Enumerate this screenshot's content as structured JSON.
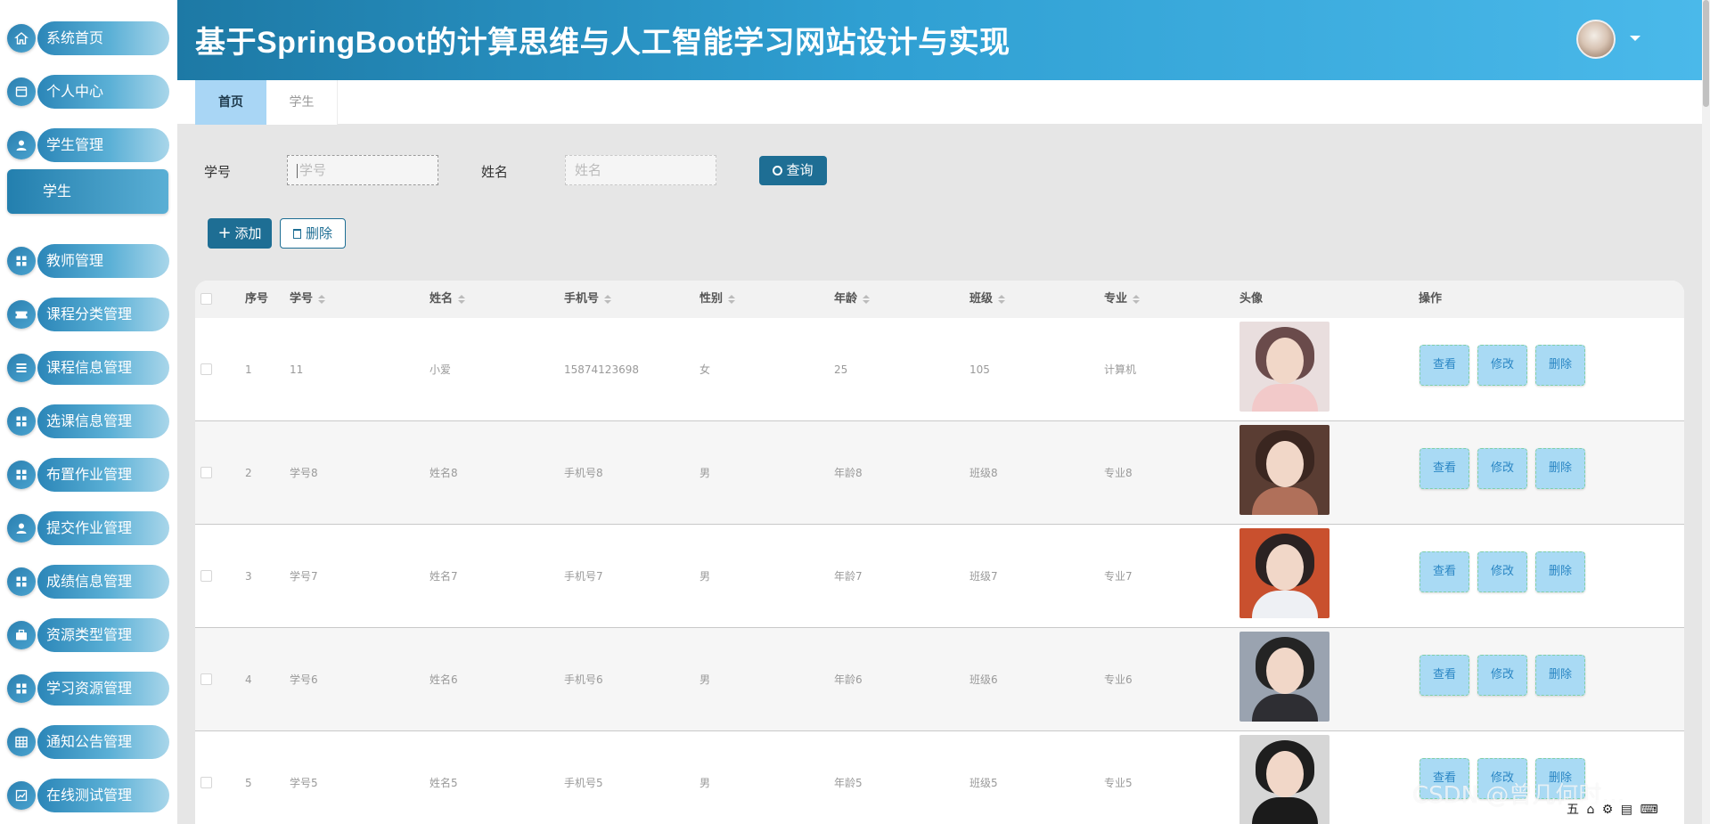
{
  "app": {
    "title": "基于SpringBoot的计算思维与人工智能学习网站设计与实现"
  },
  "sidebar": {
    "items": [
      {
        "label": "系统首页",
        "icon": "home-icon"
      },
      {
        "label": "个人中心",
        "icon": "profile-icon"
      },
      {
        "label": "学生管理",
        "icon": "user-icon"
      },
      {
        "label": "教师管理",
        "icon": "grid-icon"
      },
      {
        "label": "课程分类管理",
        "icon": "ticket-icon"
      },
      {
        "label": "课程信息管理",
        "icon": "list-icon"
      },
      {
        "label": "选课信息管理",
        "icon": "grid-icon"
      },
      {
        "label": "布置作业管理",
        "icon": "grid-icon"
      },
      {
        "label": "提交作业管理",
        "icon": "user-icon"
      },
      {
        "label": "成绩信息管理",
        "icon": "grid-icon"
      },
      {
        "label": "资源类型管理",
        "icon": "briefcase-icon"
      },
      {
        "label": "学习资源管理",
        "icon": "grid-icon"
      },
      {
        "label": "通知公告管理",
        "icon": "table-icon"
      },
      {
        "label": "在线测试管理",
        "icon": "chart-icon"
      }
    ],
    "active_sub": "学生"
  },
  "tabs": [
    {
      "label": "首页",
      "active": true
    },
    {
      "label": "学生",
      "active": false
    }
  ],
  "search": {
    "student_id_label": "学号",
    "student_id_placeholder": "学号",
    "name_label": "姓名",
    "name_placeholder": "姓名",
    "query_button": "查询"
  },
  "actions": {
    "add": "添加",
    "delete": "删除"
  },
  "table": {
    "headers": {
      "index": "序号",
      "student_id": "学号",
      "name": "姓名",
      "phone": "手机号",
      "gender": "性别",
      "age": "年龄",
      "class": "班级",
      "major": "专业",
      "avatar": "头像",
      "ops": "操作"
    },
    "rows": [
      {
        "index": "1",
        "student_id": "11",
        "name": "小爱",
        "phone": "15874123698",
        "gender": "女",
        "age": "25",
        "class": "105",
        "major": "计算机"
      },
      {
        "index": "2",
        "student_id": "学号8",
        "name": "姓名8",
        "phone": "手机号8",
        "gender": "男",
        "age": "年龄8",
        "class": "班级8",
        "major": "专业8"
      },
      {
        "index": "3",
        "student_id": "学号7",
        "name": "姓名7",
        "phone": "手机号7",
        "gender": "男",
        "age": "年龄7",
        "class": "班级7",
        "major": "专业7"
      },
      {
        "index": "4",
        "student_id": "学号6",
        "name": "姓名6",
        "phone": "手机号6",
        "gender": "男",
        "age": "年龄6",
        "class": "班级6",
        "major": "专业6"
      },
      {
        "index": "5",
        "student_id": "学号5",
        "name": "姓名5",
        "phone": "手机号5",
        "gender": "男",
        "age": "年龄5",
        "class": "班级5",
        "major": "专业5"
      }
    ],
    "row_ops": {
      "view": "查看",
      "edit": "修改",
      "delete": "删除"
    }
  },
  "watermark": "CSDN @曾几何时…",
  "tray": "五 ⌂ ⚙ ▤ ⌨",
  "colors": {
    "header_start": "#1d79a5",
    "header_end": "#4ab9ea",
    "accent": "#1e6e94",
    "tab_active": "#a9d6f5",
    "op_button": "#a9daf4"
  }
}
